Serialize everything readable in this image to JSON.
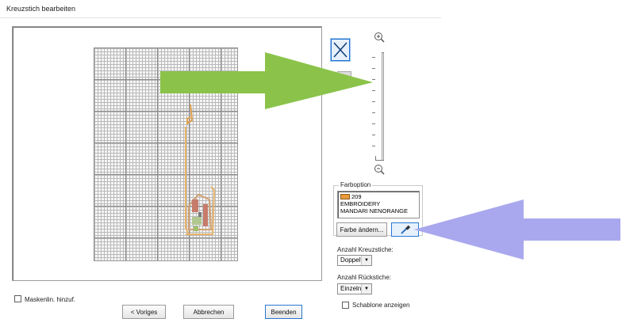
{
  "window": {
    "title": "Kreuzstich bearbeiten"
  },
  "color_option": {
    "group_label": "Farboption",
    "swatch_color": "#e99a3a",
    "color_number": "209",
    "color_line1": "EMBROIDERY",
    "color_line2": "MANDARI NENORANGE",
    "change_button": "Farbe ändern..."
  },
  "cross_stitch": {
    "label": "Anzahl Kreuzstiche:",
    "value": "Doppelt"
  },
  "back_stitch": {
    "label": "Anzahl Rückstiche:",
    "value": "Einzeln"
  },
  "template_toggle": {
    "label": "Schablone anzeigen",
    "checked": false
  },
  "mask_toggle": {
    "label": "Maskenlin. hinzuf.",
    "checked": false
  },
  "nav": {
    "back": "< Voriges",
    "cancel": "Abbrechen",
    "finish": "Beenden"
  },
  "colors": {
    "arrow_green": "#8bc34a",
    "arrow_purple": "#a9a8ee",
    "accent": "#1c6fcf"
  },
  "icons": [
    "zoom-in-icon",
    "zoom-out-icon",
    "cross-stitch-icon",
    "eyedropper-icon"
  ]
}
